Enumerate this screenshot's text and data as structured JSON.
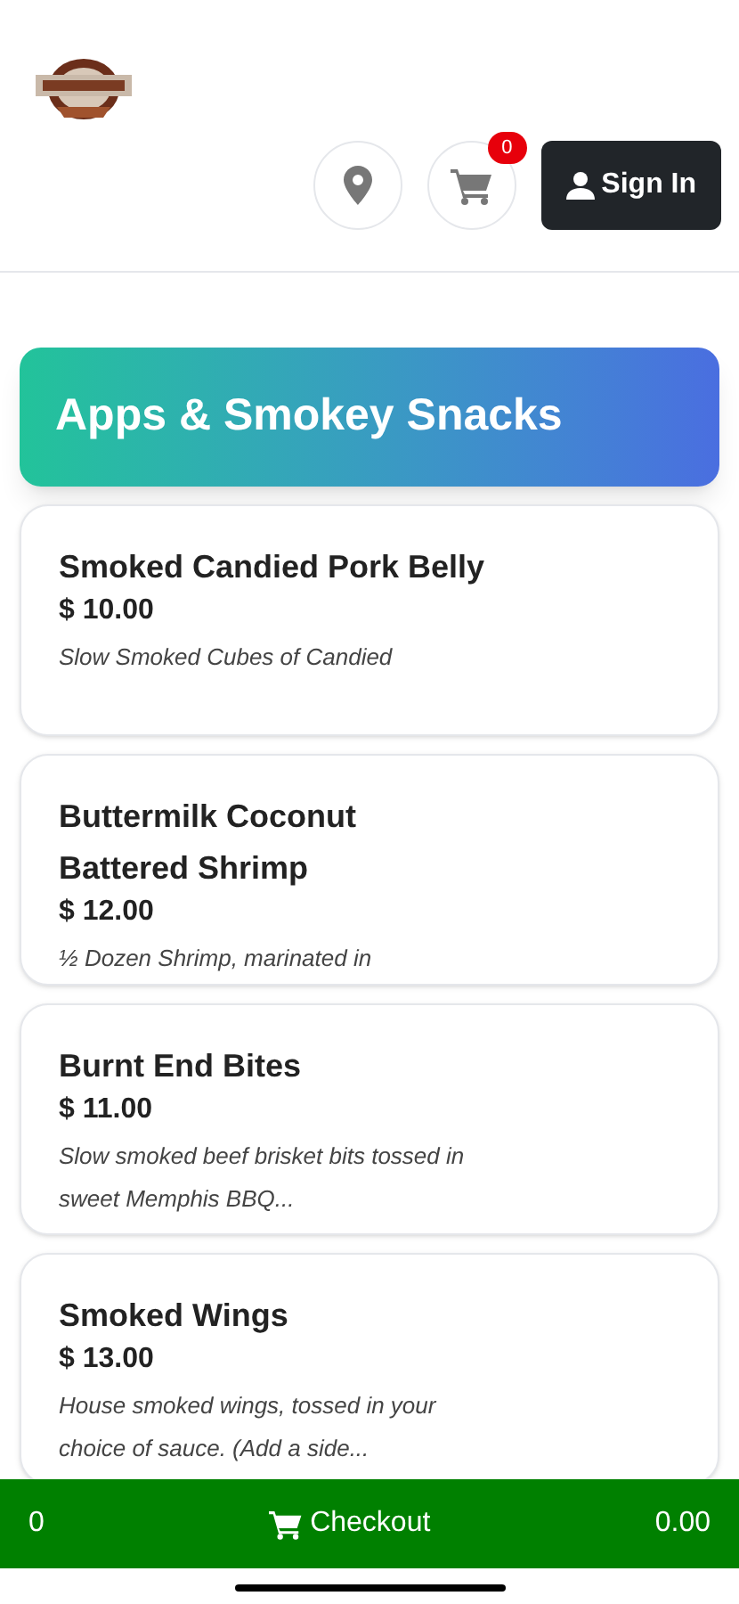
{
  "header": {
    "cart_count": "0",
    "sign_in": "Sign In"
  },
  "category": {
    "title": "Apps & Smokey Snacks"
  },
  "items": [
    {
      "name": "Smoked Candied Pork Belly",
      "price": "$ 10.00",
      "description": "Slow Smoked Cubes of Candied"
    },
    {
      "name": "Buttermilk Coconut Battered Shrimp",
      "price": "$ 12.00",
      "description": "½ Dozen Shrimp, marinated in"
    },
    {
      "name": "Burnt End Bites",
      "price": "$ 11.00",
      "description": "Slow smoked beef brisket bits tossed in sweet Memphis BBQ..."
    },
    {
      "name": "Smoked Wings",
      "price": "$ 13.00",
      "description": "House smoked wings, tossed in your choice of sauce. (Add a side..."
    }
  ],
  "checkout_bar": {
    "count": "0",
    "label": "Checkout",
    "total": "0.00"
  }
}
